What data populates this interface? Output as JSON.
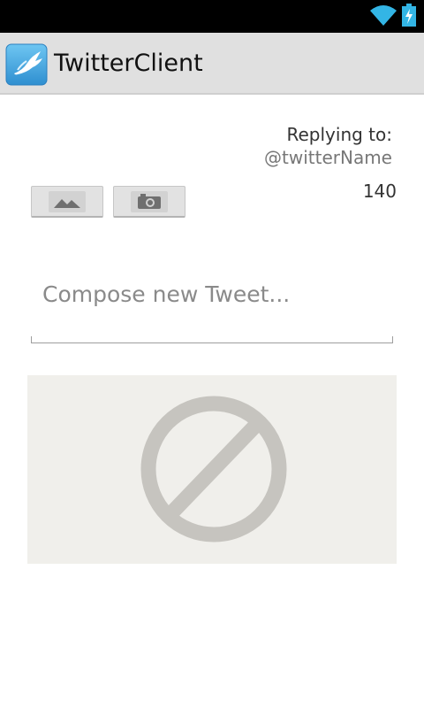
{
  "app": {
    "title": "TwitterClient",
    "icon": "bird-logo-icon"
  },
  "status_bar": {
    "icons": [
      "wifi-icon",
      "battery-charging-icon"
    ]
  },
  "reply": {
    "label": "Replying to:",
    "username": "@twitterName"
  },
  "char_counter": "140",
  "media_buttons": {
    "gallery_icon": "image-gallery-icon",
    "camera_icon": "camera-icon"
  },
  "compose": {
    "placeholder": "Compose new Tweet..."
  },
  "image_preview": {
    "icon": "no-image-icon"
  },
  "colors": {
    "action_bar": "#e0e0e0",
    "status_bar": "#000000",
    "accent": "#33b5e5",
    "preview_bg": "#f0efeb",
    "no_image_glyph": "#c6c4bf"
  }
}
